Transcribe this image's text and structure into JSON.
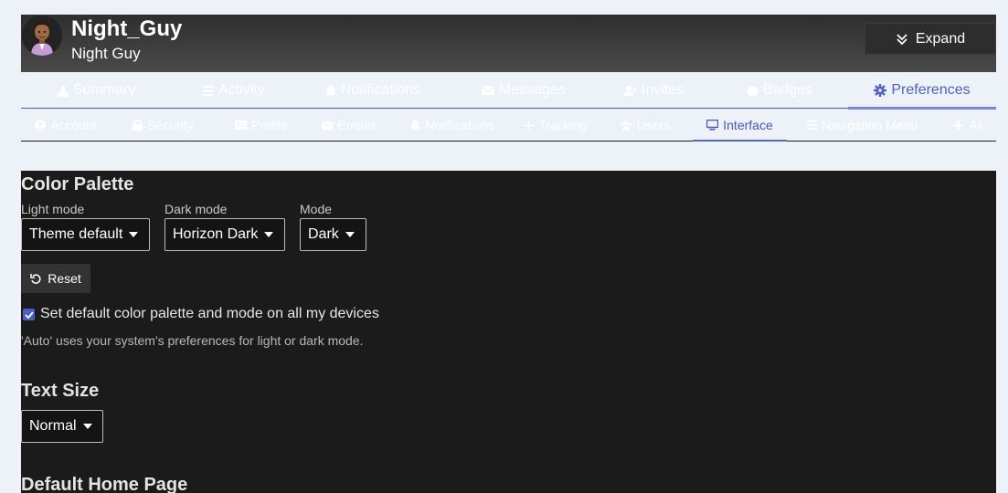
{
  "header": {
    "username": "Night_Guy",
    "full_name": "Night Guy",
    "expand_label": "Expand"
  },
  "primary_nav": [
    {
      "label": "Summary",
      "icon": "user-icon"
    },
    {
      "label": "Activity",
      "icon": "stream-icon"
    },
    {
      "label": "Notifications",
      "icon": "bell-icon"
    },
    {
      "label": "Messages",
      "icon": "envelope-icon"
    },
    {
      "label": "Invites",
      "icon": "user-plus-icon"
    },
    {
      "label": "Badges",
      "icon": "badge-icon"
    },
    {
      "label": "Preferences",
      "icon": "gear-icon",
      "active": true
    }
  ],
  "secondary_nav": [
    {
      "label": "Account",
      "icon": "user-circle-icon"
    },
    {
      "label": "Security",
      "icon": "lock-icon"
    },
    {
      "label": "Profile",
      "icon": "id-card-icon"
    },
    {
      "label": "Emails",
      "icon": "envelope-icon"
    },
    {
      "label": "Notifications",
      "icon": "bell-icon"
    },
    {
      "label": "Tracking",
      "icon": "plus-icon"
    },
    {
      "label": "Users",
      "icon": "users-icon"
    },
    {
      "label": "Interface",
      "icon": "desktop-icon",
      "active": true
    },
    {
      "label": "Navigation Menu",
      "icon": "bars-icon"
    },
    {
      "label": "AI",
      "icon": "sparkle-icon"
    }
  ],
  "color_palette": {
    "title": "Color Palette",
    "light_mode_label": "Light mode",
    "light_mode_value": "Theme default",
    "dark_mode_label": "Dark mode",
    "dark_mode_value": "Horizon Dark",
    "mode_label": "Mode",
    "mode_value": "Dark",
    "reset_label": "Reset",
    "default_checkbox_label": "Set default color palette and mode on all my devices",
    "default_checkbox_checked": true,
    "hint": "'Auto' uses your system's preferences for light or dark mode."
  },
  "text_size": {
    "title": "Text Size",
    "value": "Normal"
  },
  "default_home": {
    "title": "Default Home Page"
  },
  "colors": {
    "accent": "#5260c3",
    "panel_bg": "#1b1b1b",
    "page_bg": "#edf1f8"
  }
}
